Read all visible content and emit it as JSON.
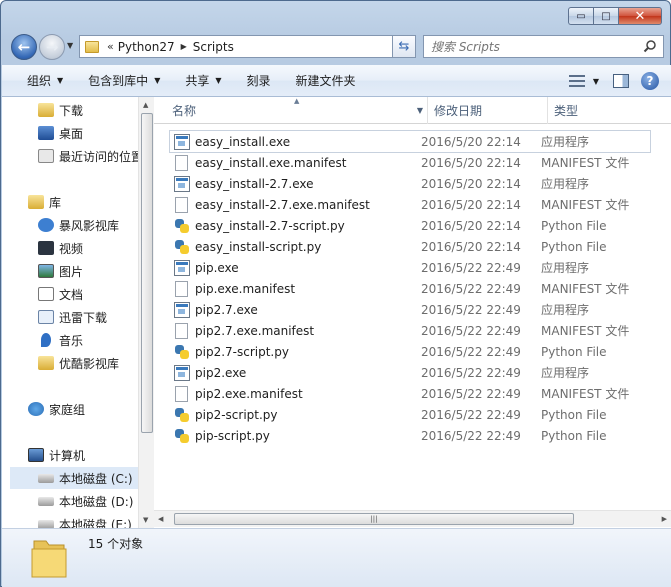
{
  "window": {
    "caption_min": "▭",
    "caption_max": "□",
    "caption_close": "✕"
  },
  "address": {
    "overflow": "«",
    "crumbs": [
      "Python27",
      "Scripts"
    ]
  },
  "search": {
    "placeholder": "搜索 Scripts"
  },
  "toolbar": {
    "organize": "组织",
    "include_in_library": "包含到库中",
    "share": "共享",
    "burn": "刻录",
    "new_folder": "新建文件夹"
  },
  "navpane": {
    "favorites": [
      {
        "label": "下载",
        "icon": "download-folder-icon"
      },
      {
        "label": "桌面",
        "icon": "desktop-icon"
      },
      {
        "label": "最近访问的位置",
        "icon": "recent-places-icon"
      }
    ],
    "libraries_label": "库",
    "libraries": [
      {
        "label": "暴风影视库",
        "icon": "video-library-icon"
      },
      {
        "label": "视频",
        "icon": "video-icon"
      },
      {
        "label": "图片",
        "icon": "pictures-icon"
      },
      {
        "label": "文档",
        "icon": "documents-icon"
      },
      {
        "label": "迅雷下载",
        "icon": "thunder-download-icon"
      },
      {
        "label": "音乐",
        "icon": "music-icon"
      },
      {
        "label": "优酷影视库",
        "icon": "youku-library-icon"
      }
    ],
    "homegroup": "家庭组",
    "computer": "计算机",
    "drives": [
      {
        "label": "本地磁盘 (C:)",
        "selected": true
      },
      {
        "label": "本地磁盘 (D:)",
        "selected": false
      },
      {
        "label": "本地磁盘 (E:)",
        "selected": false
      }
    ]
  },
  "columns": {
    "name": "名称",
    "date": "修改日期",
    "type": "类型"
  },
  "files": [
    {
      "name": "easy_install.exe",
      "date": "2016/5/20 22:14",
      "type": "应用程序",
      "kind": "exe"
    },
    {
      "name": "easy_install.exe.manifest",
      "date": "2016/5/20 22:14",
      "type": "MANIFEST 文件",
      "kind": "doc"
    },
    {
      "name": "easy_install-2.7.exe",
      "date": "2016/5/20 22:14",
      "type": "应用程序",
      "kind": "exe"
    },
    {
      "name": "easy_install-2.7.exe.manifest",
      "date": "2016/5/20 22:14",
      "type": "MANIFEST 文件",
      "kind": "doc"
    },
    {
      "name": "easy_install-2.7-script.py",
      "date": "2016/5/20 22:14",
      "type": "Python File",
      "kind": "py"
    },
    {
      "name": "easy_install-script.py",
      "date": "2016/5/20 22:14",
      "type": "Python File",
      "kind": "py"
    },
    {
      "name": "pip.exe",
      "date": "2016/5/22 22:49",
      "type": "应用程序",
      "kind": "exe"
    },
    {
      "name": "pip.exe.manifest",
      "date": "2016/5/22 22:49",
      "type": "MANIFEST 文件",
      "kind": "doc"
    },
    {
      "name": "pip2.7.exe",
      "date": "2016/5/22 22:49",
      "type": "应用程序",
      "kind": "exe"
    },
    {
      "name": "pip2.7.exe.manifest",
      "date": "2016/5/22 22:49",
      "type": "MANIFEST 文件",
      "kind": "doc"
    },
    {
      "name": "pip2.7-script.py",
      "date": "2016/5/22 22:49",
      "type": "Python File",
      "kind": "py"
    },
    {
      "name": "pip2.exe",
      "date": "2016/5/22 22:49",
      "type": "应用程序",
      "kind": "exe"
    },
    {
      "name": "pip2.exe.manifest",
      "date": "2016/5/22 22:49",
      "type": "MANIFEST 文件",
      "kind": "doc"
    },
    {
      "name": "pip2-script.py",
      "date": "2016/5/22 22:49",
      "type": "Python File",
      "kind": "py"
    },
    {
      "name": "pip-script.py",
      "date": "2016/5/22 22:49",
      "type": "Python File",
      "kind": "py"
    }
  ],
  "status": {
    "count_text": "15 个对象"
  },
  "icons": {
    "back": "arrow-left-icon",
    "forward": "arrow-right-icon",
    "refresh": "refresh-icon",
    "search": "search-icon",
    "view": "view-options-icon",
    "preview_pane": "preview-pane-icon",
    "help": "help-icon"
  }
}
